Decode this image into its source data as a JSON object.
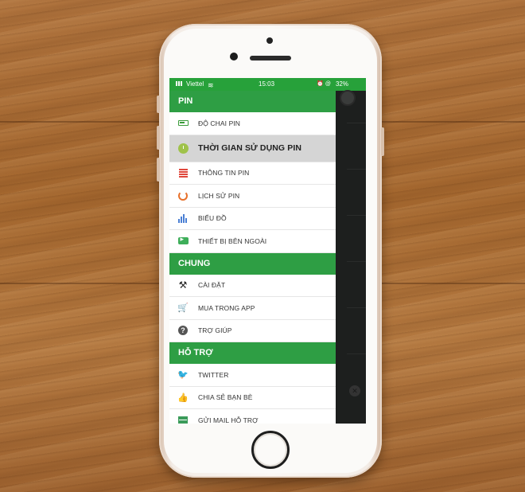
{
  "status_bar": {
    "carrier": "Viettel",
    "time": "15:03",
    "battery": "32%"
  },
  "menu": {
    "sections": [
      {
        "header": "PIN",
        "items": [
          {
            "label": "ĐỘ CHAI PIN",
            "icon": "battery-icon"
          },
          {
            "label": "THỜI GIAN SỬ DỤNG PIN",
            "icon": "clock-icon",
            "active": true
          },
          {
            "label": "THÔNG TIN PIN",
            "icon": "list-icon"
          },
          {
            "label": "LỊCH SỬ PIN",
            "icon": "history-icon"
          },
          {
            "label": "BIỂU ĐỒ",
            "icon": "chart-icon"
          },
          {
            "label": "THIẾT BỊ BÊN NGOÀI",
            "icon": "external-device-icon"
          }
        ]
      },
      {
        "header": "CHUNG",
        "items": [
          {
            "label": "CÀI ĐẶT",
            "icon": "tools-icon"
          },
          {
            "label": "MUA TRONG APP",
            "icon": "cart-icon"
          },
          {
            "label": "TRỢ GIÚP",
            "icon": "help-icon"
          }
        ]
      },
      {
        "header": "HỖ TRỢ",
        "items": [
          {
            "label": "TWITTER",
            "icon": "twitter-icon"
          },
          {
            "label": "CHIA SẺ BẠN BÈ",
            "icon": "thumbs-up-icon"
          },
          {
            "label": "GỬI MAIL HỖ TRỢ",
            "icon": "mail-icon"
          }
        ]
      }
    ]
  },
  "colors": {
    "header_green": "#2e9e44",
    "active_row": "#d5d5d5",
    "wood": "#a5682f"
  }
}
